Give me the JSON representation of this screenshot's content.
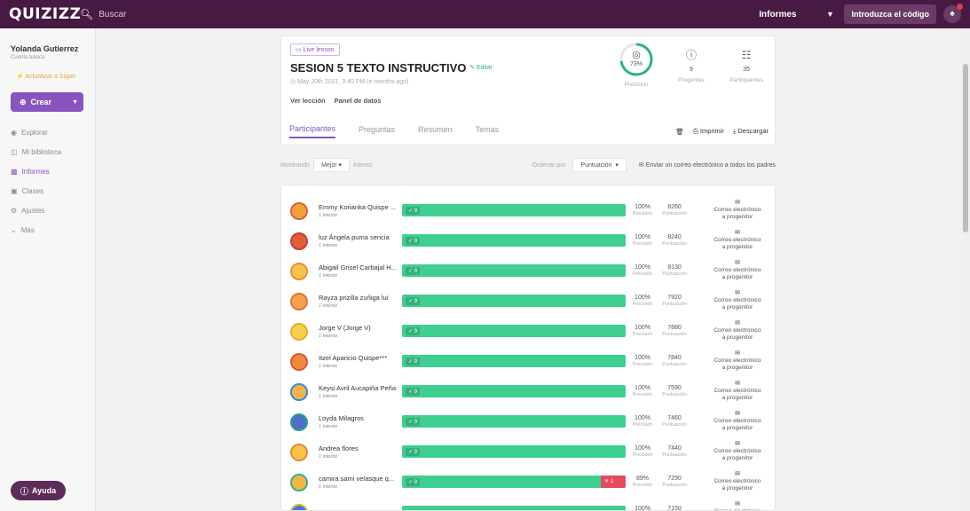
{
  "topbar": {
    "logo": "QUIZIZZ",
    "search_placeholder": "Buscar",
    "reports_label": "Informes",
    "code_button": "Introduzca el código"
  },
  "sidebar": {
    "user_name": "Yolanda Gutierrez",
    "user_role": "Cuenta básica",
    "upgrade_label": "Actualizar a Súper",
    "create_label": "Crear",
    "items": [
      {
        "label": "Explorar",
        "icon": "compass-icon",
        "active": false
      },
      {
        "label": "Mi biblioteca",
        "icon": "folder-icon",
        "active": false
      },
      {
        "label": "Informes",
        "icon": "chart-icon",
        "active": true
      },
      {
        "label": "Clases",
        "icon": "classes-icon",
        "active": false
      },
      {
        "label": "Ajustes",
        "icon": "gear-icon",
        "active": false
      },
      {
        "label": "Más",
        "icon": "chevron-down-icon",
        "active": false
      }
    ],
    "help_label": "Ayuda"
  },
  "header": {
    "badge": "Live lesson",
    "title": "SESION 5 TEXTO INSTRUCTIVO",
    "edit_label": "Editar",
    "date": "May 20th 2021, 3:40 PM (e months ago)",
    "links": [
      "Ver lección",
      "Panel de datos"
    ],
    "stats": {
      "accuracy_value": "73%",
      "accuracy_fraction": 0.73,
      "accuracy_label": "Precisión",
      "questions_value": "9",
      "questions_label": "Preguntas",
      "participants_value": "35",
      "participants_label": "Participantes"
    }
  },
  "tabs": {
    "items": [
      "Participantes",
      "Preguntas",
      "Resumen",
      "Temas"
    ],
    "active": 0,
    "print_label": "Imprimir",
    "download_label": "Descargar"
  },
  "filters": {
    "showing_label": "Mostrando",
    "showing_value": "Mejor",
    "attempt_label": "Intento",
    "sort_label": "Ordenar por",
    "sort_value": "Puntuación",
    "mail_all": "Enviar un correo electrónico a todos los padres"
  },
  "list": {
    "attempt_text": "1 intento",
    "accuracy_sub": "Precisión",
    "score_sub": "Puntuación",
    "mail_text": "Correo electrónico a progenitor",
    "rows": [
      {
        "name": "Emmy Korianka Quispe ...",
        "correct": "9",
        "wrong": "",
        "accuracy": "100%",
        "score": "8260"
      },
      {
        "name": "luz Ángela puma sencia",
        "correct": "9",
        "wrong": "",
        "accuracy": "100%",
        "score": "8240"
      },
      {
        "name": "Abigail Grisel Carbajal H...",
        "correct": "9",
        "wrong": "",
        "accuracy": "100%",
        "score": "8130"
      },
      {
        "name": "Rayza prizilla zuñiga lui",
        "correct": "9",
        "wrong": "",
        "accuracy": "100%",
        "score": "7920"
      },
      {
        "name": "Jorge V (Jorge V)",
        "correct": "9",
        "wrong": "",
        "accuracy": "100%",
        "score": "7880"
      },
      {
        "name": "Itzel Aparicio Quispe***",
        "correct": "9",
        "wrong": "",
        "accuracy": "100%",
        "score": "7840"
      },
      {
        "name": "Keysi Avril Aucapiña Peña",
        "correct": "9",
        "wrong": "",
        "accuracy": "100%",
        "score": "7590"
      },
      {
        "name": "Loyda Milagros",
        "correct": "9",
        "wrong": "",
        "accuracy": "100%",
        "score": "7460"
      },
      {
        "name": "Andrea flores",
        "correct": "9",
        "wrong": "",
        "accuracy": "100%",
        "score": "7440"
      },
      {
        "name": "camira sami velasque q...",
        "correct": "8",
        "wrong": "1",
        "accuracy": "89%",
        "score": "7290"
      },
      {
        "name": "",
        "correct": "",
        "wrong": "",
        "accuracy": "100%",
        "score": "7150"
      }
    ]
  }
}
